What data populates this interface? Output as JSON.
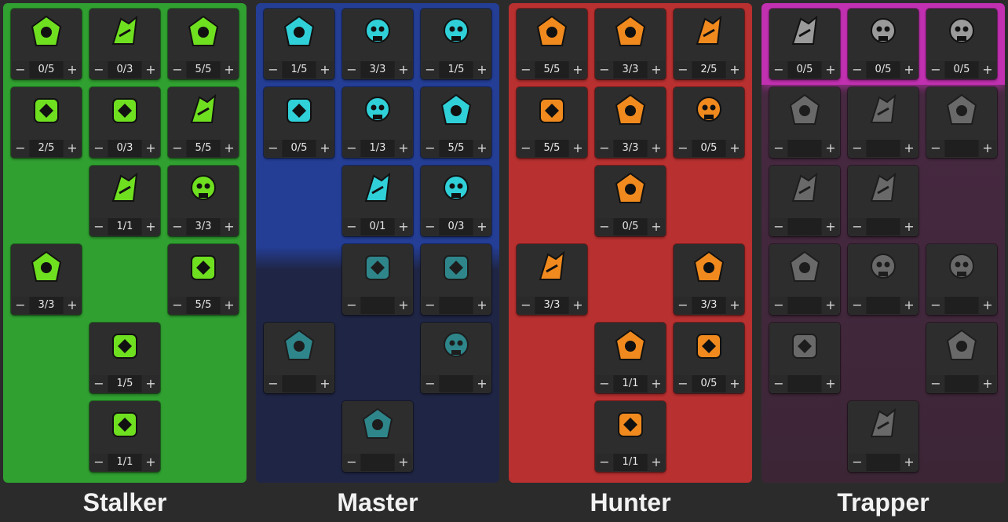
{
  "colors": {
    "stalker": "#30a030",
    "master_top": "#243e96",
    "master_bottom": "#1f2544",
    "hunter": "#b83030",
    "trapper_top": "#4a2a44",
    "trapper_accent": "#c030b0",
    "stalker_icon": "#6fe020",
    "master_icon": "#30d0d8",
    "hunter_icon": "#f08a1e",
    "trapper_icon": "#9a9a9a"
  },
  "controls": {
    "minus": "−",
    "plus": "+"
  },
  "trees": [
    {
      "name": "Stalker",
      "nodes": [
        {
          "icon": "slash-badge-icon",
          "value": "0/5"
        },
        {
          "icon": "claw-swipe-icon",
          "value": "0/3"
        },
        {
          "icon": "bat-icon",
          "value": "5/5"
        },
        {
          "icon": "bear-head-icon",
          "value": "2/5"
        },
        {
          "icon": "medkit-stack-icon",
          "value": "0/3"
        },
        {
          "icon": "shotgun-shells-icon",
          "value": "5/5"
        },
        {
          "icon": "backpack-icon",
          "value": "1/1"
        },
        {
          "icon": "winged-arrow-icon",
          "value": "3/3"
        },
        {
          "icon": "winged-boot-icon",
          "value": "3/3"
        },
        {
          "icon": "bandana-skull-icon",
          "value": "5/5"
        },
        {
          "icon": "trash-can-icon",
          "value": "1/5"
        },
        {
          "icon": "jester-skull-icon",
          "value": "1/1"
        }
      ]
    },
    {
      "name": "Master",
      "nodes": [
        {
          "icon": "crossed-bones-icon",
          "value": "1/5"
        },
        {
          "icon": "crosshair-icon",
          "value": "3/3"
        },
        {
          "icon": "tiger-head-icon",
          "value": "1/5"
        },
        {
          "icon": "paw-tag-icon",
          "value": "0/5"
        },
        {
          "icon": "pufferfish-icon",
          "value": "1/3"
        },
        {
          "icon": "spiky-head-icon",
          "value": "5/5"
        },
        {
          "icon": "whistle-icon",
          "value": "0/1"
        },
        {
          "icon": "paw-shield-icon",
          "value": "0/3"
        },
        {
          "icon": "roaring-bear-icon",
          "value": ""
        },
        {
          "icon": "spiked-shell-icon",
          "value": ""
        },
        {
          "icon": "paw-bucket-icon",
          "value": ""
        },
        {
          "icon": "fish-icon",
          "value": ""
        },
        {
          "icon": "stun-baton-icon",
          "value": ""
        }
      ]
    },
    {
      "name": "Hunter",
      "nodes": [
        {
          "icon": "skull-icon",
          "value": "5/5"
        },
        {
          "icon": "winged-bullet-icon",
          "value": "3/3"
        },
        {
          "icon": "skull-cycle-icon",
          "value": "2/5"
        },
        {
          "icon": "eagle-head-icon",
          "value": "5/5"
        },
        {
          "icon": "dragon-icon",
          "value": "3/3"
        },
        {
          "icon": "scope-icon",
          "value": "0/5"
        },
        {
          "icon": "boots-icon",
          "value": "0/5"
        },
        {
          "icon": "up-grenade-icon",
          "value": "3/3"
        },
        {
          "icon": "skull-crate-icon",
          "value": "3/3"
        },
        {
          "icon": "target-skull-icon",
          "value": "1/1"
        },
        {
          "icon": "crossed-guns-icon",
          "value": "0/5"
        },
        {
          "icon": "burning-hand-icon",
          "value": "1/1"
        }
      ]
    },
    {
      "name": "Trapper",
      "nodes": [
        {
          "icon": "rabbit-icon",
          "value": "0/5"
        },
        {
          "icon": "bear-trap-icon",
          "value": "0/5"
        },
        {
          "icon": "grenade-icon",
          "value": "0/5"
        },
        {
          "icon": "helmet-icon",
          "value": ""
        },
        {
          "icon": "paw-target-icon",
          "value": ""
        },
        {
          "icon": "fanged-mouth-icon",
          "value": ""
        },
        {
          "icon": "bomb-icon",
          "value": ""
        },
        {
          "icon": "paw-badge-icon",
          "value": ""
        },
        {
          "icon": "beast-icon",
          "value": ""
        },
        {
          "icon": "hound-icon",
          "value": ""
        },
        {
          "icon": "jaw-trap-icon",
          "value": ""
        },
        {
          "icon": "stone-skull-icon",
          "value": ""
        },
        {
          "icon": "up-arrow-shield-icon",
          "value": ""
        },
        {
          "icon": "knight-helm-icon",
          "value": ""
        }
      ]
    }
  ]
}
